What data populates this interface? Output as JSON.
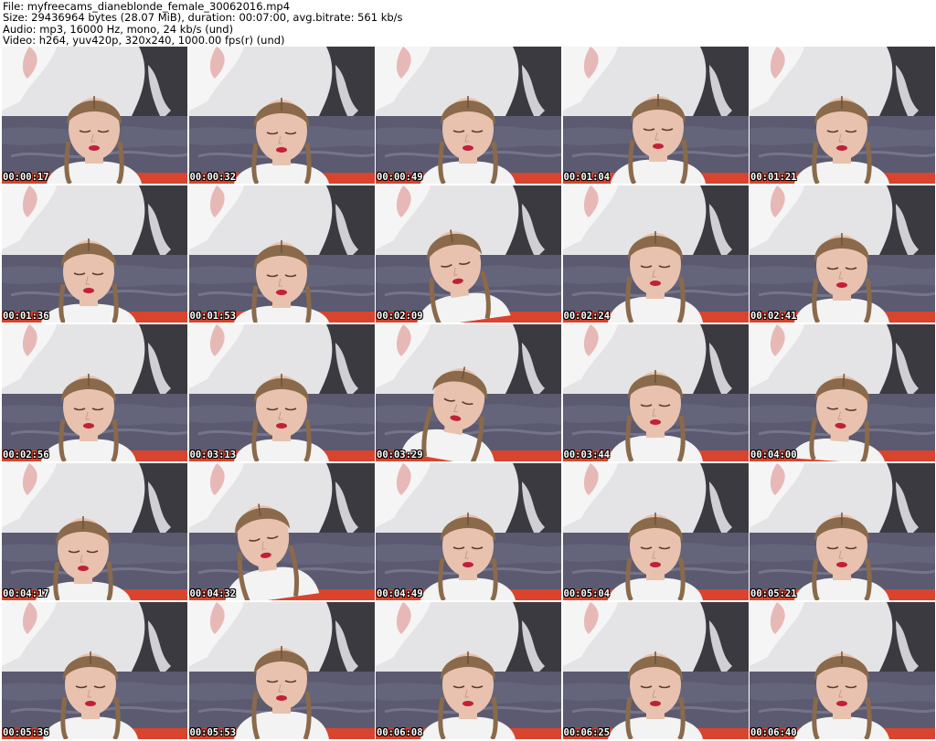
{
  "header": {
    "line1": "File: myfreecams_dianeblonde_female_30062016.mp4",
    "line2": "Size: 29436964 bytes (28.07 MiB), duration: 00:07:00, avg.bitrate: 561 kb/s",
    "line3": "Audio: mp3, 16000 Hz, mono, 24 kb/s (und)",
    "line4": "Video: h264, yuv420p, 320x240, 1000.00 fps(r) (und)"
  },
  "thumbnails": [
    {
      "timestamp": "00:00:17"
    },
    {
      "timestamp": "00:00:32"
    },
    {
      "timestamp": "00:00:49"
    },
    {
      "timestamp": "00:01:04"
    },
    {
      "timestamp": "00:01:21"
    },
    {
      "timestamp": "00:01:36"
    },
    {
      "timestamp": "00:01:53"
    },
    {
      "timestamp": "00:02:09"
    },
    {
      "timestamp": "00:02:24"
    },
    {
      "timestamp": "00:02:41"
    },
    {
      "timestamp": "00:02:56"
    },
    {
      "timestamp": "00:03:13"
    },
    {
      "timestamp": "00:03:29"
    },
    {
      "timestamp": "00:03:44"
    },
    {
      "timestamp": "00:04:00"
    },
    {
      "timestamp": "00:04:17"
    },
    {
      "timestamp": "00:04:32"
    },
    {
      "timestamp": "00:04:49"
    },
    {
      "timestamp": "00:05:04"
    },
    {
      "timestamp": "00:05:21"
    },
    {
      "timestamp": "00:05:36"
    },
    {
      "timestamp": "00:05:53"
    },
    {
      "timestamp": "00:06:08"
    },
    {
      "timestamp": "00:06:25"
    },
    {
      "timestamp": "00:06:40"
    }
  ],
  "colors": {
    "background": "#ffffff",
    "wall": "#e4e4e6",
    "dark_panel": "#3a3a40",
    "couch": "#5b5a70",
    "red_strip": "#d8442e",
    "skin": "#e8c2ae",
    "hair": "#8a6a4a",
    "lips": "#c0203a",
    "shirt": "#f3f3f3"
  }
}
